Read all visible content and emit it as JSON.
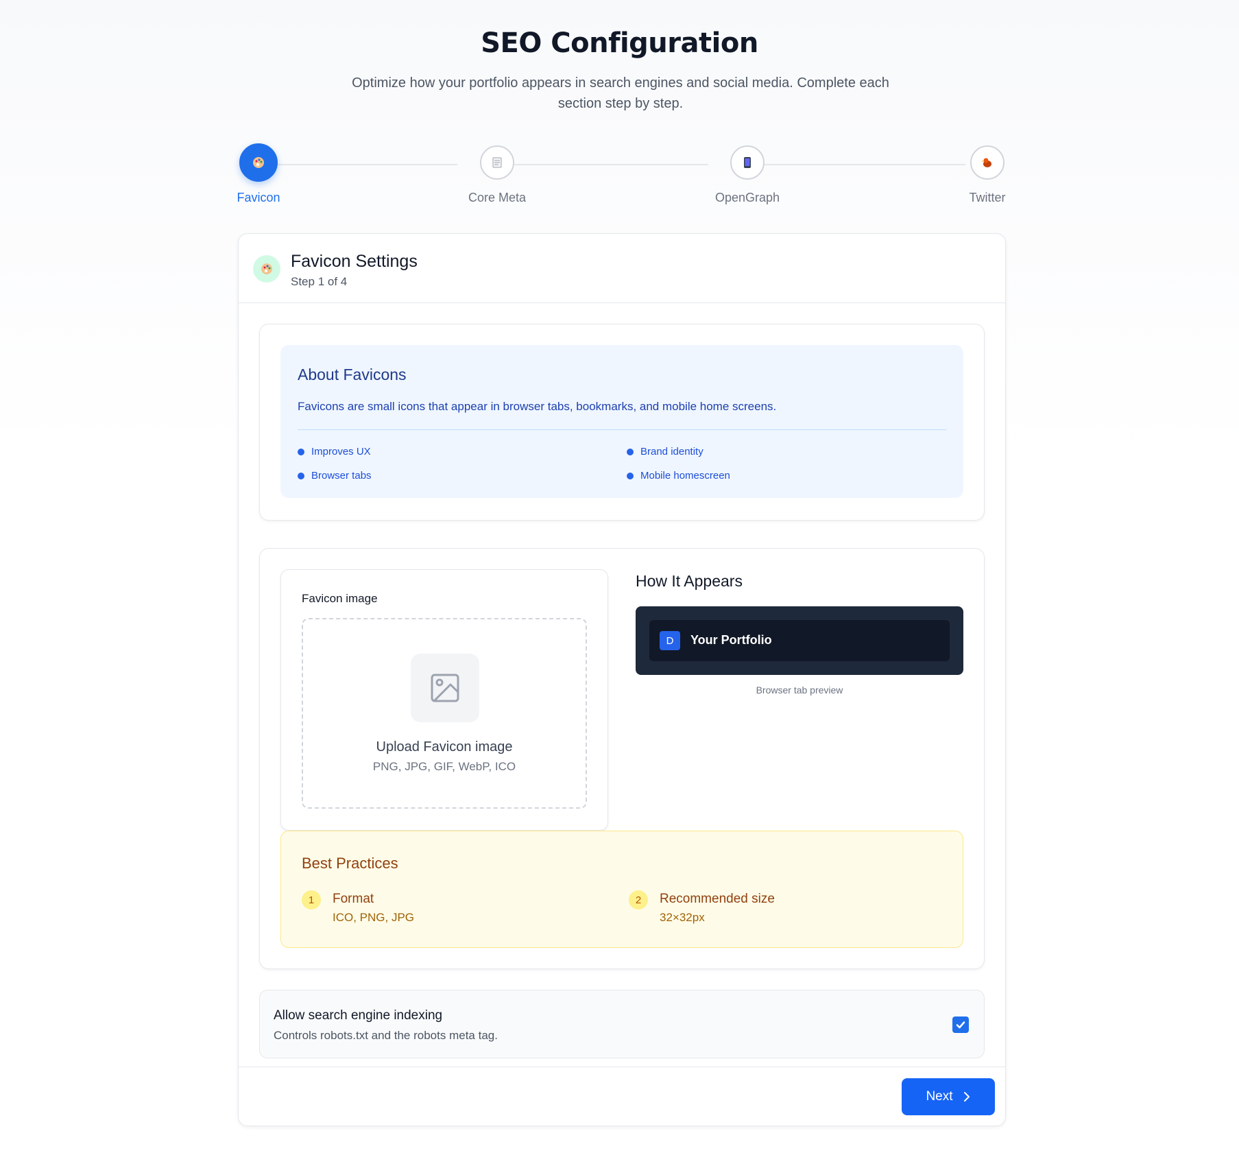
{
  "header": {
    "title": "SEO Configuration",
    "subtitle": "Optimize how your portfolio appears in search engines and social media. Complete each section step by step."
  },
  "stepper": {
    "steps": [
      {
        "label": "Favicon",
        "icon": "palette-icon",
        "active": true
      },
      {
        "label": "Core Meta",
        "icon": "document-icon",
        "active": false
      },
      {
        "label": "OpenGraph",
        "icon": "phone-icon",
        "active": false
      },
      {
        "label": "Twitter",
        "icon": "bird-icon",
        "active": false
      }
    ]
  },
  "card": {
    "title": "Favicon Settings",
    "step_text": "Step 1 of 4",
    "icon": "palette-icon"
  },
  "about": {
    "title": "About Favicons",
    "text": "Favicons are small icons that appear in browser tabs, bookmarks, and mobile home screens.",
    "bullets": [
      "Improves UX",
      "Brand identity",
      "Browser tabs",
      "Mobile homescreen"
    ]
  },
  "upload": {
    "label": "Favicon image",
    "title": "Upload Favicon image",
    "formats": "PNG, JPG, GIF, WebP, ICO"
  },
  "preview": {
    "title": "How It Appears",
    "favicon_letter": "D",
    "tab_text": "Your Portfolio",
    "caption": "Browser tab preview"
  },
  "practices": {
    "title": "Best Practices",
    "items": [
      {
        "num": "1",
        "name": "Format",
        "value": "ICO, PNG, JPG"
      },
      {
        "num": "2",
        "name": "Recommended size",
        "value": "32×32px"
      }
    ]
  },
  "indexing": {
    "title": "Allow search engine indexing",
    "subtitle": "Controls robots.txt and the robots meta tag.",
    "checked": true
  },
  "footer": {
    "next_label": "Next"
  },
  "colors": {
    "primary": "#1f6feb",
    "about_bg": "#eff6ff",
    "practices_bg": "#fefce8",
    "tab_preview_bg": "#1e293b"
  }
}
